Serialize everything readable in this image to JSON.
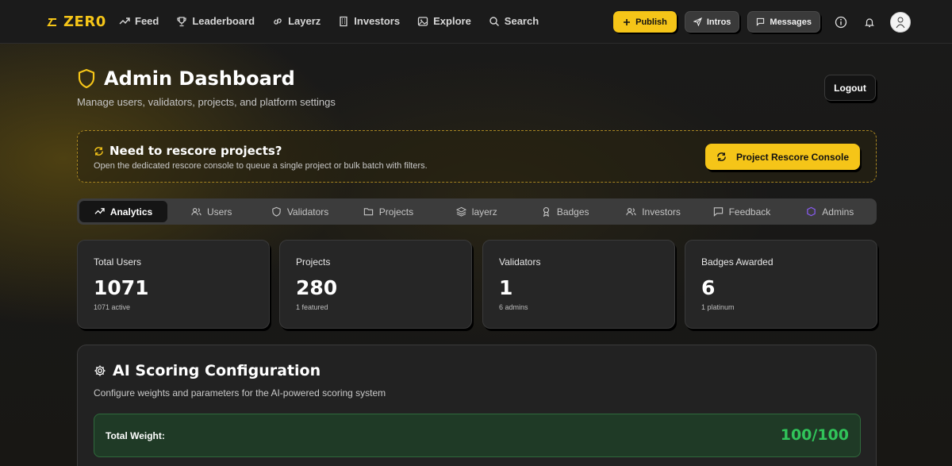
{
  "nav": {
    "brand": "ZER0",
    "links": [
      {
        "label": "Feed",
        "icon": "trending-up-icon"
      },
      {
        "label": "Leaderboard",
        "icon": "trophy-icon"
      },
      {
        "label": "Layerz",
        "icon": "link-icon"
      },
      {
        "label": "Investors",
        "icon": "building-icon"
      },
      {
        "label": "Explore",
        "icon": "image-icon"
      },
      {
        "label": "Search",
        "icon": "search-icon"
      }
    ],
    "publish_label": "Publish",
    "intros_label": "Intros",
    "messages_label": "Messages"
  },
  "header": {
    "title": "Admin Dashboard",
    "subtitle": "Manage users, validators, projects, and platform settings",
    "logout_label": "Logout"
  },
  "rescore": {
    "title": "Need to rescore projects?",
    "description": "Open the dedicated rescore console to queue a single project or bulk batch with filters.",
    "button_label": "Project Rescore Console"
  },
  "tabs": [
    {
      "label": "Analytics",
      "icon": "trending-up-icon",
      "active": true
    },
    {
      "label": "Users",
      "icon": "users-icon"
    },
    {
      "label": "Validators",
      "icon": "shield-icon"
    },
    {
      "label": "Projects",
      "icon": "folder-icon"
    },
    {
      "label": "layerz",
      "icon": "layers-icon"
    },
    {
      "label": "Badges",
      "icon": "award-icon"
    },
    {
      "label": "Investors",
      "icon": "users-icon"
    },
    {
      "label": "Feedback",
      "icon": "message-icon"
    },
    {
      "label": "Admins",
      "icon": "hexagon-icon"
    }
  ],
  "stats": [
    {
      "label": "Total Users",
      "value": "1071",
      "sub": "1071 active"
    },
    {
      "label": "Projects",
      "value": "280",
      "sub": "1 featured"
    },
    {
      "label": "Validators",
      "value": "1",
      "sub": "6 admins"
    },
    {
      "label": "Badges Awarded",
      "value": "6",
      "sub": "1 platinum"
    }
  ],
  "ai_scoring": {
    "title": "AI Scoring Configuration",
    "description": "Configure weights and parameters for the AI-powered scoring system",
    "total_weight_label": "Total Weight:",
    "total_weight_value": "100/100"
  },
  "colors": {
    "accent": "#f5c518",
    "success": "#31c45a",
    "admins_icon": "#8b5cf6"
  }
}
